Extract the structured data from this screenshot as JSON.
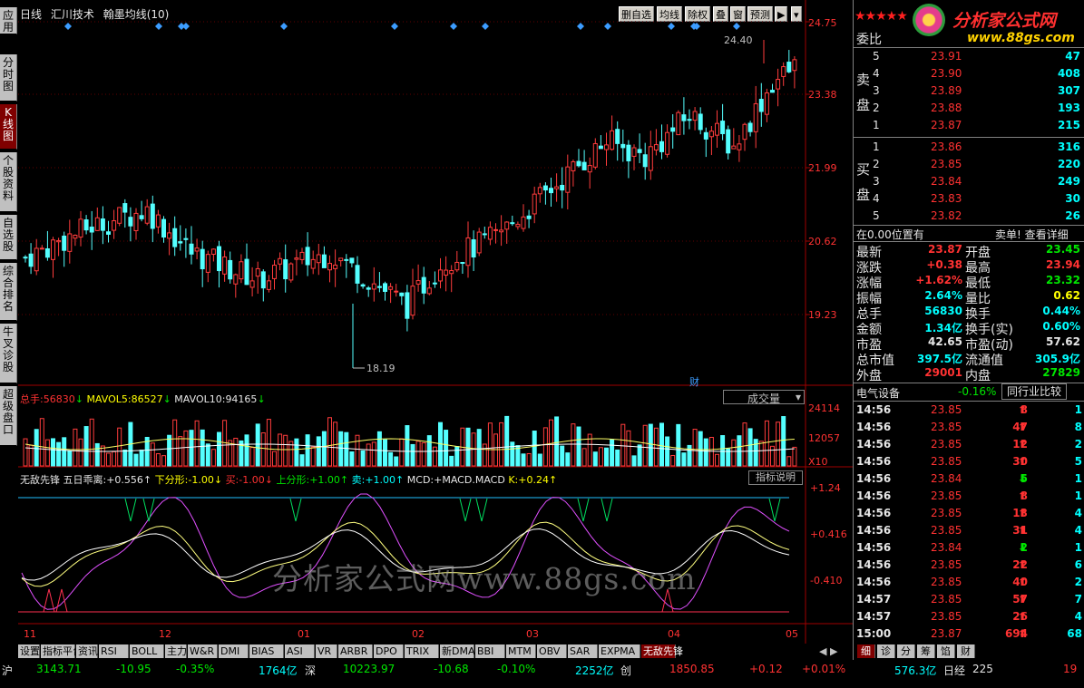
{
  "chart_header": {
    "period": "日线",
    "source": "汇川技术",
    "indicator": "翰墨均线(10)"
  },
  "toolbar": [
    "删自选",
    "均线",
    "除权",
    "叠",
    "窗",
    "预测"
  ],
  "toolbar_arrow": "▶",
  "sidebar": [
    {
      "label": "应用",
      "active": false
    },
    {
      "label": "分时图",
      "active": false
    },
    {
      "label": "K线图",
      "active": true
    },
    {
      "label": "个股资料",
      "active": false
    },
    {
      "label": "自选股",
      "active": false
    },
    {
      "label": "综合排名",
      "active": false
    },
    {
      "label": "牛叉诊股",
      "active": false
    },
    {
      "label": "超级盘口",
      "active": false
    }
  ],
  "price_axis": [
    "24.75",
    "23.38",
    "21.99",
    "20.62",
    "19.23"
  ],
  "price_annotations": {
    "high": "24.40",
    "low": "18.19"
  },
  "fin_badge": "财",
  "volume_panel": {
    "label": "总手:",
    "value": "56830",
    "arrow": "↓",
    "ma5_label": "MAVOL5:",
    "ma5": "86527",
    "ma10_label": "MAVOL10:",
    "ma10": "94165",
    "dropdown": "成交量",
    "axis": [
      "24114",
      "12057",
      "X10"
    ]
  },
  "indicator_panel": {
    "name": "无敌先锋",
    "l1": "五日乖离:",
    "v1": "+0.556↑",
    "l2": "下分形:",
    "v2": "-1.00↓",
    "l3": "买:",
    "v3": "-1.00↓",
    "l4": "上分形:",
    "v4": "+1.00↑",
    "l5": "卖:",
    "v5": "+1.00↑",
    "l6": "MCD:",
    "v6": "+MACD.MACD",
    "l7": "K:",
    "v7": "+0.24↑",
    "button": "指标说明",
    "axis": [
      "+1.24",
      "+0.416",
      "-0.410"
    ]
  },
  "watermark": "分析家公式网www.88gs.com",
  "date_axis": [
    "11",
    "12",
    "01",
    "02",
    "03",
    "04",
    "05"
  ],
  "bottom_tabs": [
    "设置",
    "指标平台",
    "资讯",
    "RSI",
    "BOLL",
    "主力",
    "W&R",
    "DMI",
    "BIAS",
    "ASI",
    "VR",
    "ARBR",
    "DPO",
    "TRIX",
    "新DMA",
    "BBI",
    "MTM",
    "OBV",
    "SAR",
    "EXPMA",
    "无敌先锋"
  ],
  "right_tabs": [
    "细",
    "诊",
    "分",
    "筹",
    "馅",
    "财"
  ],
  "logo": {
    "text": "分析家公式网",
    "url": "www.88gs.com"
  },
  "orderbook": {
    "header": "委比",
    "sell_label": "卖盘",
    "buy_label": "买盘",
    "sells": [
      {
        "lv": "5",
        "p": "23.91",
        "v": "47"
      },
      {
        "lv": "4",
        "p": "23.90",
        "v": "408"
      },
      {
        "lv": "3",
        "p": "23.89",
        "v": "307"
      },
      {
        "lv": "2",
        "p": "23.88",
        "v": "193"
      },
      {
        "lv": "1",
        "p": "23.87",
        "v": "215"
      }
    ],
    "buys": [
      {
        "lv": "1",
        "p": "23.86",
        "v": "316"
      },
      {
        "lv": "2",
        "p": "23.85",
        "v": "220"
      },
      {
        "lv": "3",
        "p": "23.84",
        "v": "249"
      },
      {
        "lv": "4",
        "p": "23.83",
        "v": "30"
      },
      {
        "lv": "5",
        "p": "23.82",
        "v": "26"
      }
    ],
    "note_left": "在0.00位置有",
    "note_right": "卖单! 查看详细"
  },
  "stats": [
    {
      "l1": "最新",
      "v1": "23.87",
      "c1": "red",
      "l2": "开盘",
      "v2": "23.45",
      "c2": "green"
    },
    {
      "l1": "涨跌",
      "v1": "+0.38",
      "c1": "red",
      "l2": "最高",
      "v2": "23.94",
      "c2": "red"
    },
    {
      "l1": "涨幅",
      "v1": "+1.62%",
      "c1": "red",
      "l2": "最低",
      "v2": "23.32",
      "c2": "green"
    },
    {
      "l1": "振幅",
      "v1": "2.64%",
      "c1": "cyan",
      "l2": "量比",
      "v2": "0.62",
      "c2": "yellow"
    },
    {
      "l1": "总手",
      "v1": "56830",
      "c1": "cyan",
      "l2": "换手",
      "v2": "0.44%",
      "c2": "cyan"
    },
    {
      "l1": "金额",
      "v1": "1.34亿",
      "c1": "cyan",
      "l2": "换手(实)",
      "v2": "0.60%",
      "c2": "cyan"
    },
    {
      "l1": "市盈",
      "v1": "42.65",
      "c1": "white",
      "l2": "市盈(动)",
      "v2": "57.62",
      "c2": "white"
    },
    {
      "l1": "总市值",
      "v1": "397.5亿",
      "c1": "cyan",
      "l2": "流通值",
      "v2": "305.9亿",
      "c2": "cyan"
    },
    {
      "l1": "外盘",
      "v1": "29001",
      "c1": "red",
      "l2": "内盘",
      "v2": "27829",
      "c2": "green"
    }
  ],
  "sector": {
    "name": "电气设备",
    "change": "-0.16%",
    "button": "同行业比较"
  },
  "ticks": [
    {
      "t": "14:56",
      "p": "23.85",
      "pc": "red",
      "v": "8",
      "vc": "red",
      "d": "up",
      "n": "1"
    },
    {
      "t": "14:56",
      "p": "23.85",
      "pc": "red",
      "v": "47",
      "vc": "red",
      "d": "up",
      "n": "8"
    },
    {
      "t": "14:56",
      "p": "23.85",
      "pc": "red",
      "v": "12",
      "vc": "red",
      "d": "up",
      "n": "2"
    },
    {
      "t": "14:56",
      "p": "23.85",
      "pc": "red",
      "v": "30",
      "vc": "red",
      "d": "up",
      "n": "5"
    },
    {
      "t": "14:56",
      "p": "23.84",
      "pc": "red",
      "v": "5",
      "vc": "green",
      "d": "down",
      "n": "1"
    },
    {
      "t": "14:56",
      "p": "23.85",
      "pc": "red",
      "v": "8",
      "vc": "red",
      "d": "up",
      "n": "1"
    },
    {
      "t": "14:56",
      "p": "23.85",
      "pc": "red",
      "v": "13",
      "vc": "red",
      "d": "up",
      "n": "4"
    },
    {
      "t": "14:56",
      "p": "23.85",
      "pc": "red",
      "v": "31",
      "vc": "red",
      "d": "up",
      "n": "4"
    },
    {
      "t": "14:56",
      "p": "23.84",
      "pc": "red",
      "v": "2",
      "vc": "green",
      "d": "down",
      "n": "1"
    },
    {
      "t": "14:56",
      "p": "23.85",
      "pc": "red",
      "v": "22",
      "vc": "red",
      "d": "up",
      "n": "6"
    },
    {
      "t": "14:56",
      "p": "23.85",
      "pc": "red",
      "v": "40",
      "vc": "red",
      "d": "up",
      "n": "2"
    },
    {
      "t": "14:57",
      "p": "23.85",
      "pc": "red",
      "v": "57",
      "vc": "red",
      "d": "up",
      "n": "7"
    },
    {
      "t": "14:57",
      "p": "23.85",
      "pc": "red",
      "v": "26",
      "vc": "red",
      "d": "up",
      "n": "4"
    },
    {
      "t": "15:00",
      "p": "23.87",
      "pc": "red",
      "v": "694",
      "vc": "red",
      "d": "up",
      "n": "68"
    }
  ],
  "status": {
    "sh_label": "沪",
    "sh_idx": "3143.71",
    "sh_chg": "-10.95",
    "sh_pct": "-0.35%",
    "sh_amt": "1764亿",
    "sz_label": "深",
    "sz_idx": "10223.97",
    "sz_chg": "-10.68",
    "sz_pct": "-0.10%",
    "sz_amt": "2252亿",
    "cy_label": "创",
    "cy_idx": "1850.85",
    "cy_chg": "+0.12",
    "cy_pct": "+0.01%",
    "cy_amt": "576.3亿",
    "nk_label": "日经",
    "nk_idx": "225",
    "end": "19"
  }
}
